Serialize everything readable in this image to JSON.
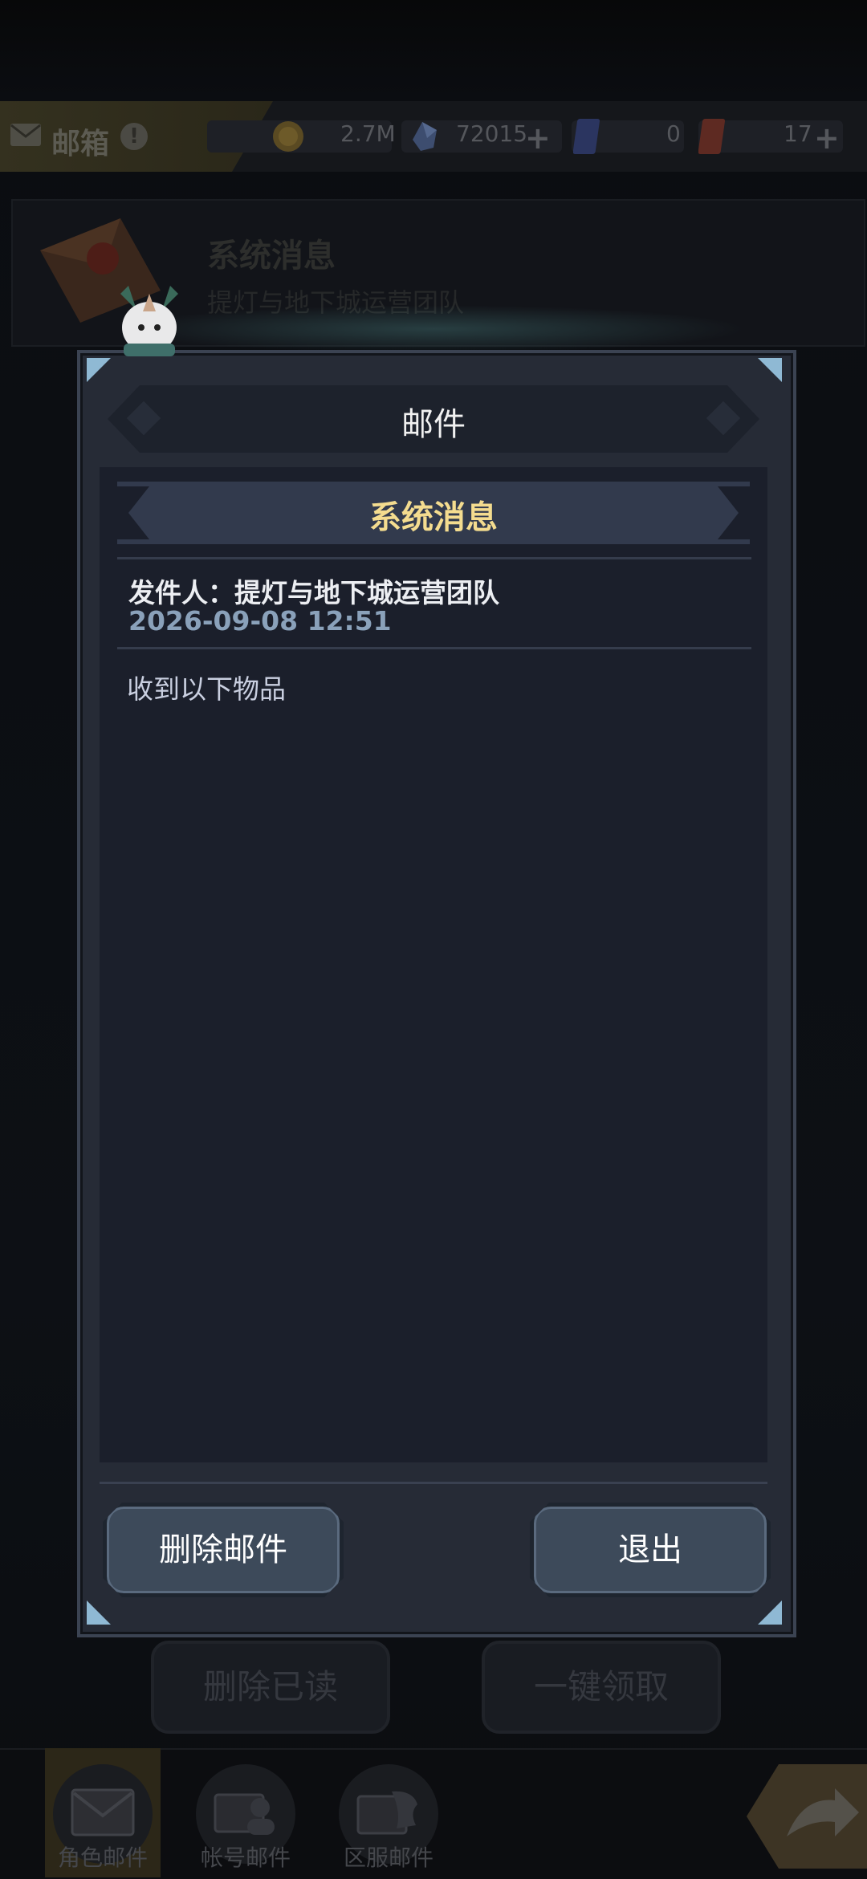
{
  "topbar": {
    "mailbox_title": "邮箱",
    "alert": "!",
    "resources": [
      {
        "icon": "gold-coin-icon",
        "value": "2.7M"
      },
      {
        "icon": "crystal-icon",
        "value": "72015"
      },
      {
        "icon": "ticket-card-icon",
        "value": "0"
      },
      {
        "icon": "gold-card-icon",
        "value": "17"
      }
    ]
  },
  "mail_list": {
    "item_title": "系统消息",
    "item_sender": "提灯与地下城运营团队"
  },
  "modal": {
    "title": "邮件",
    "banner_title": "系统消息",
    "sender": "发件人：提灯与地下城运营团队",
    "datetime": "2026-09-08 12:51",
    "body": "收到以下物品",
    "delete_label": "删除邮件",
    "exit_label": "退出"
  },
  "background_buttons": {
    "delete_read": "删除已读",
    "claim_all": "一键领取"
  },
  "bottom_nav": [
    {
      "label": "角色邮件",
      "icon": "envelope-icon",
      "active": true
    },
    {
      "label": "帐号邮件",
      "icon": "account-mail-icon",
      "active": false
    },
    {
      "label": "区服邮件",
      "icon": "server-mail-icon",
      "active": false
    }
  ],
  "colors": {
    "accent_gold": "#f4dc8f",
    "datetime_blue": "#8aa1ba",
    "button_face": "#3d4a5a"
  }
}
